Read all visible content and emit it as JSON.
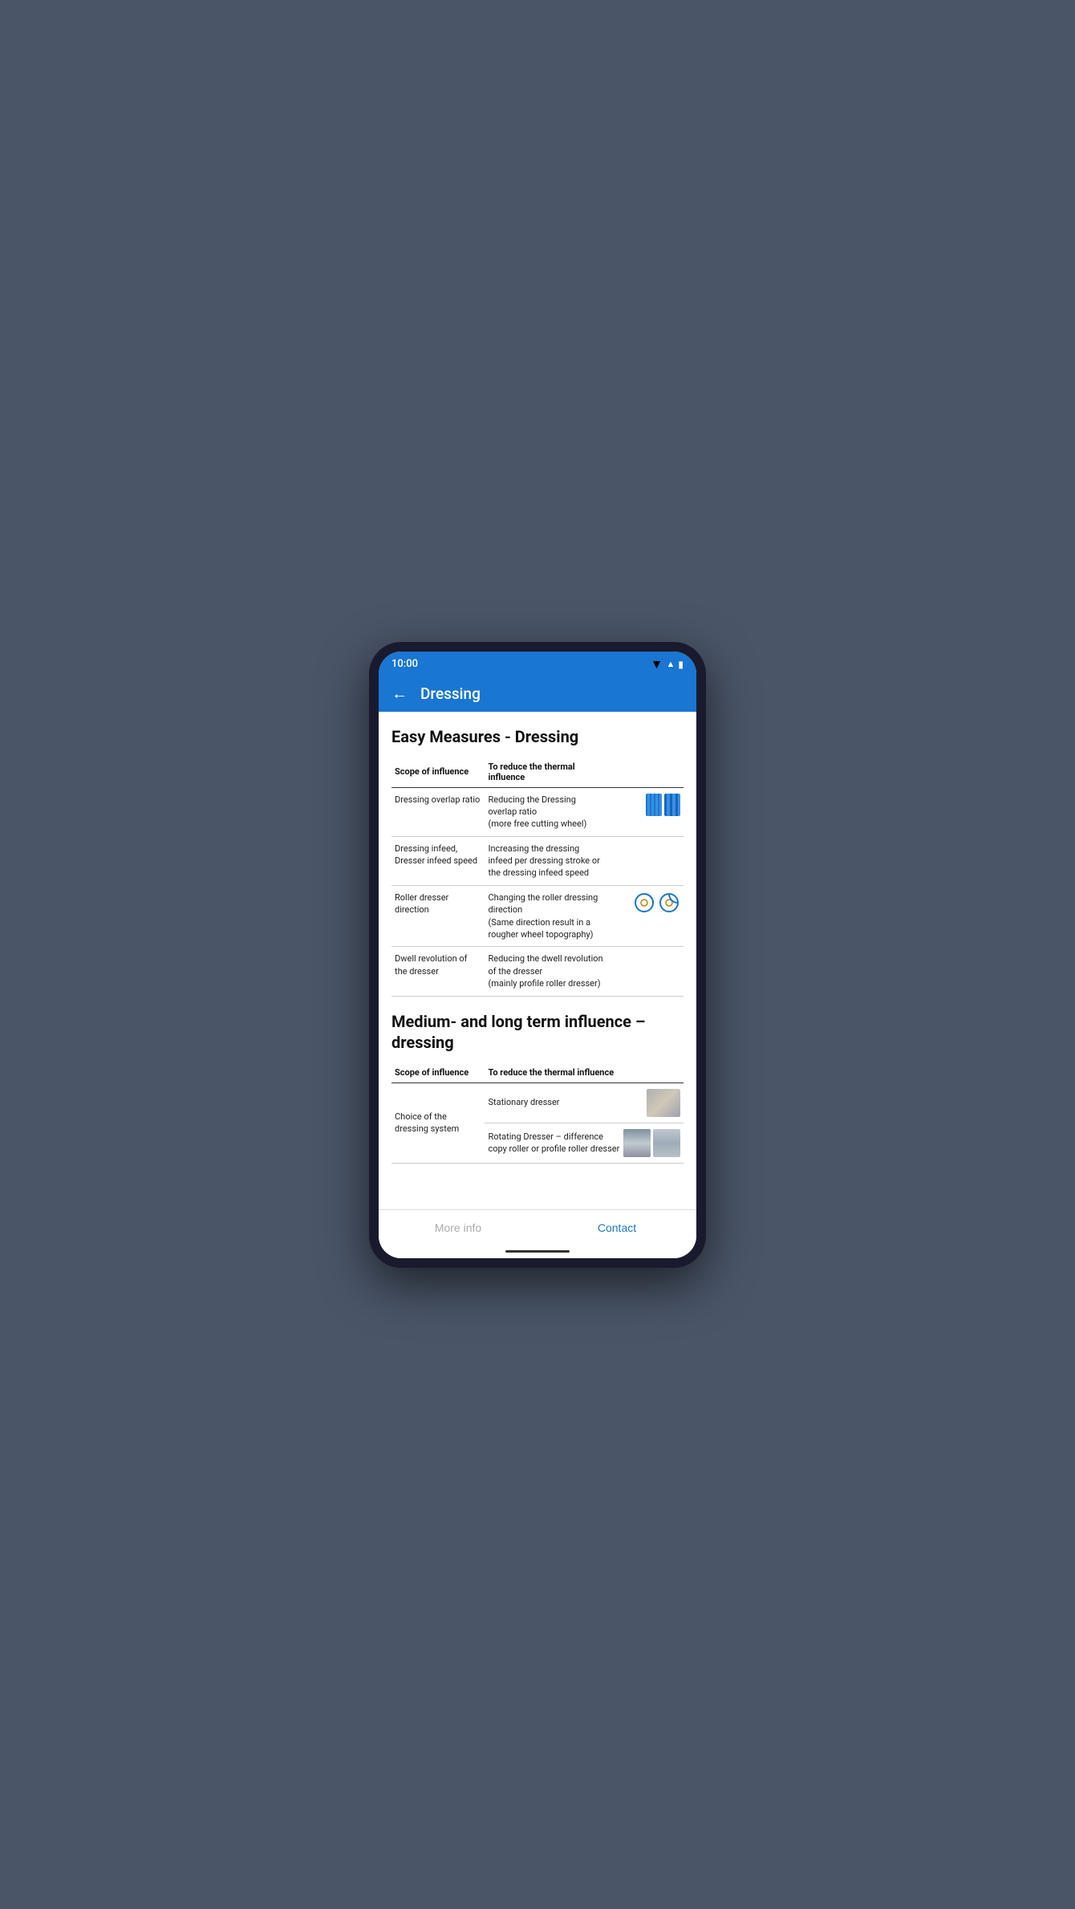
{
  "statusBar": {
    "time": "10:00",
    "wifi": "▼",
    "signal": "▲",
    "battery": "▮"
  },
  "appBar": {
    "backLabel": "←",
    "title": "Dressing"
  },
  "section1": {
    "title": "Easy Measures - Dressing",
    "tableHeaders": {
      "scope": "Scope of influence",
      "reduce": "To reduce the thermal influence"
    },
    "rows": [
      {
        "scope": "Dressing overlap ratio",
        "reduce": "Reducing the Dressing overlap ratio\n(more free cutting wheel)",
        "hasWheels": true
      },
      {
        "scope": "Dressing infeed, Dresser infeed speed",
        "reduce": "Increasing the dressing infeed per dressing stroke or the dressing infeed speed",
        "hasWheels": false
      },
      {
        "scope": "Roller dresser direction",
        "reduce": "Changing the roller dressing direction\n(Same direction result in a rougher wheel topography)",
        "hasDresser": true
      },
      {
        "scope": "Dwell revolution of the dresser",
        "reduce": "Reducing the dwell revolution of the dresser\n(mainly profile roller dresser)",
        "hasWheels": false
      }
    ]
  },
  "section2": {
    "title": "Medium- and long term influence – dressing",
    "tableHeaders": {
      "scope": "Scope of influence",
      "reduce": "To reduce the thermal influence"
    },
    "rows": [
      {
        "scope": "Choice of the dressing system",
        "reduce1": "Stationary dresser",
        "reduce2": "Rotating Dresser – difference copy roller or profile roller dresser"
      }
    ]
  },
  "bottomBar": {
    "moreInfo": "More info",
    "contact": "Contact"
  }
}
